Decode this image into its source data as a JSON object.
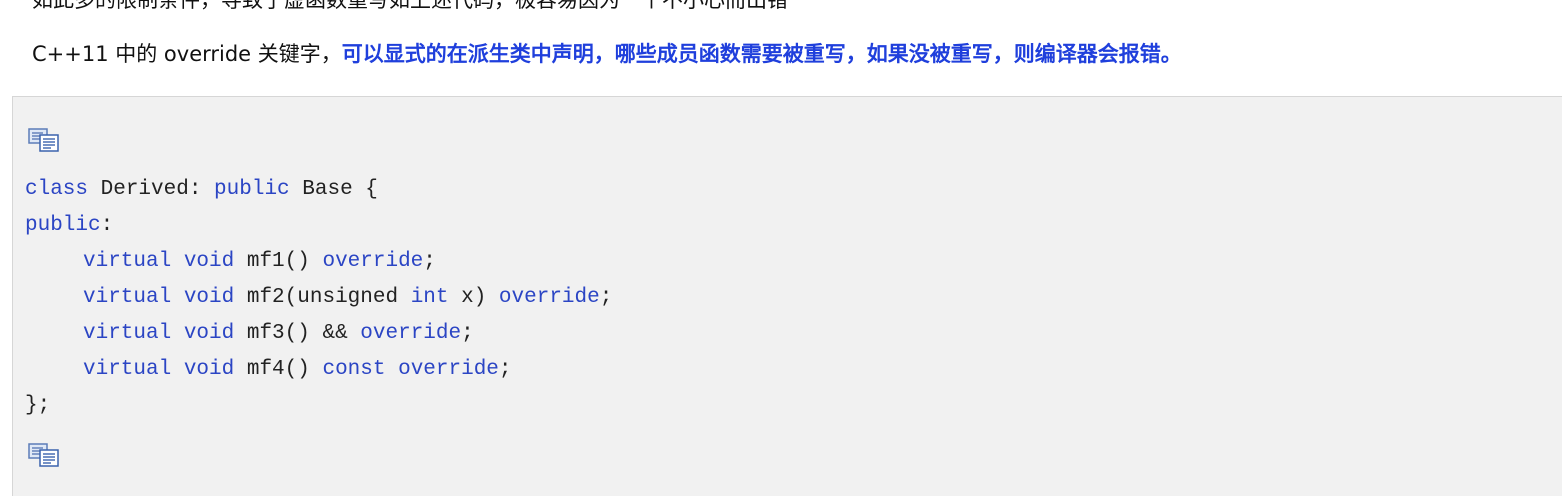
{
  "article": {
    "cut_line": "如此多的限制条件，导致了虚函数重写如上述代码，极容易因为一个不小心而出错",
    "intro_prefix": "C++11 中的 override 关键字，",
    "intro_emphasis": "可以显式的在派生类中声明，哪些成员函数需要被重写，如果没被重写，则编译器会报错。"
  },
  "code_block": {
    "copy_icon_top": "copy-icon",
    "copy_icon_bottom": "copy-icon",
    "lines": [
      {
        "parts": [
          {
            "t": "class",
            "kw": true
          },
          {
            "t": " Derived: ",
            "kw": false
          },
          {
            "t": "public",
            "kw": true
          },
          {
            "t": " Base {",
            "kw": false
          }
        ]
      },
      {
        "parts": [
          {
            "t": "public",
            "kw": true
          },
          {
            "t": ":",
            "kw": false
          }
        ]
      },
      {
        "indent": true,
        "parts": [
          {
            "t": "virtual",
            "kw": true
          },
          {
            "t": " ",
            "kw": false
          },
          {
            "t": "void",
            "kw": true
          },
          {
            "t": " mf1() ",
            "kw": false
          },
          {
            "t": "override",
            "kw": true
          },
          {
            "t": ";",
            "kw": false
          }
        ]
      },
      {
        "indent": true,
        "parts": [
          {
            "t": "virtual",
            "kw": true
          },
          {
            "t": " ",
            "kw": false
          },
          {
            "t": "void",
            "kw": true
          },
          {
            "t": " mf2(unsigned ",
            "kw": false
          },
          {
            "t": "int",
            "kw": true
          },
          {
            "t": " x) ",
            "kw": false
          },
          {
            "t": "override",
            "kw": true
          },
          {
            "t": ";",
            "kw": false
          }
        ]
      },
      {
        "indent": true,
        "parts": [
          {
            "t": "virtual",
            "kw": true
          },
          {
            "t": " ",
            "kw": false
          },
          {
            "t": "void",
            "kw": true
          },
          {
            "t": " mf3() && ",
            "kw": false
          },
          {
            "t": "override",
            "kw": true
          },
          {
            "t": ";",
            "kw": false
          }
        ]
      },
      {
        "indent": true,
        "parts": [
          {
            "t": "virtual",
            "kw": true
          },
          {
            "t": " ",
            "kw": false
          },
          {
            "t": "void",
            "kw": true
          },
          {
            "t": " mf4() ",
            "kw": false
          },
          {
            "t": "const",
            "kw": true
          },
          {
            "t": " ",
            "kw": false
          },
          {
            "t": "override",
            "kw": true
          },
          {
            "t": ";",
            "kw": false
          }
        ]
      },
      {
        "parts": [
          {
            "t": "};",
            "kw": false
          }
        ]
      }
    ]
  },
  "colors": {
    "keyword": "#2b45c4",
    "emphasis": "#1f3fdc",
    "code_bg": "#f1f1f1"
  }
}
